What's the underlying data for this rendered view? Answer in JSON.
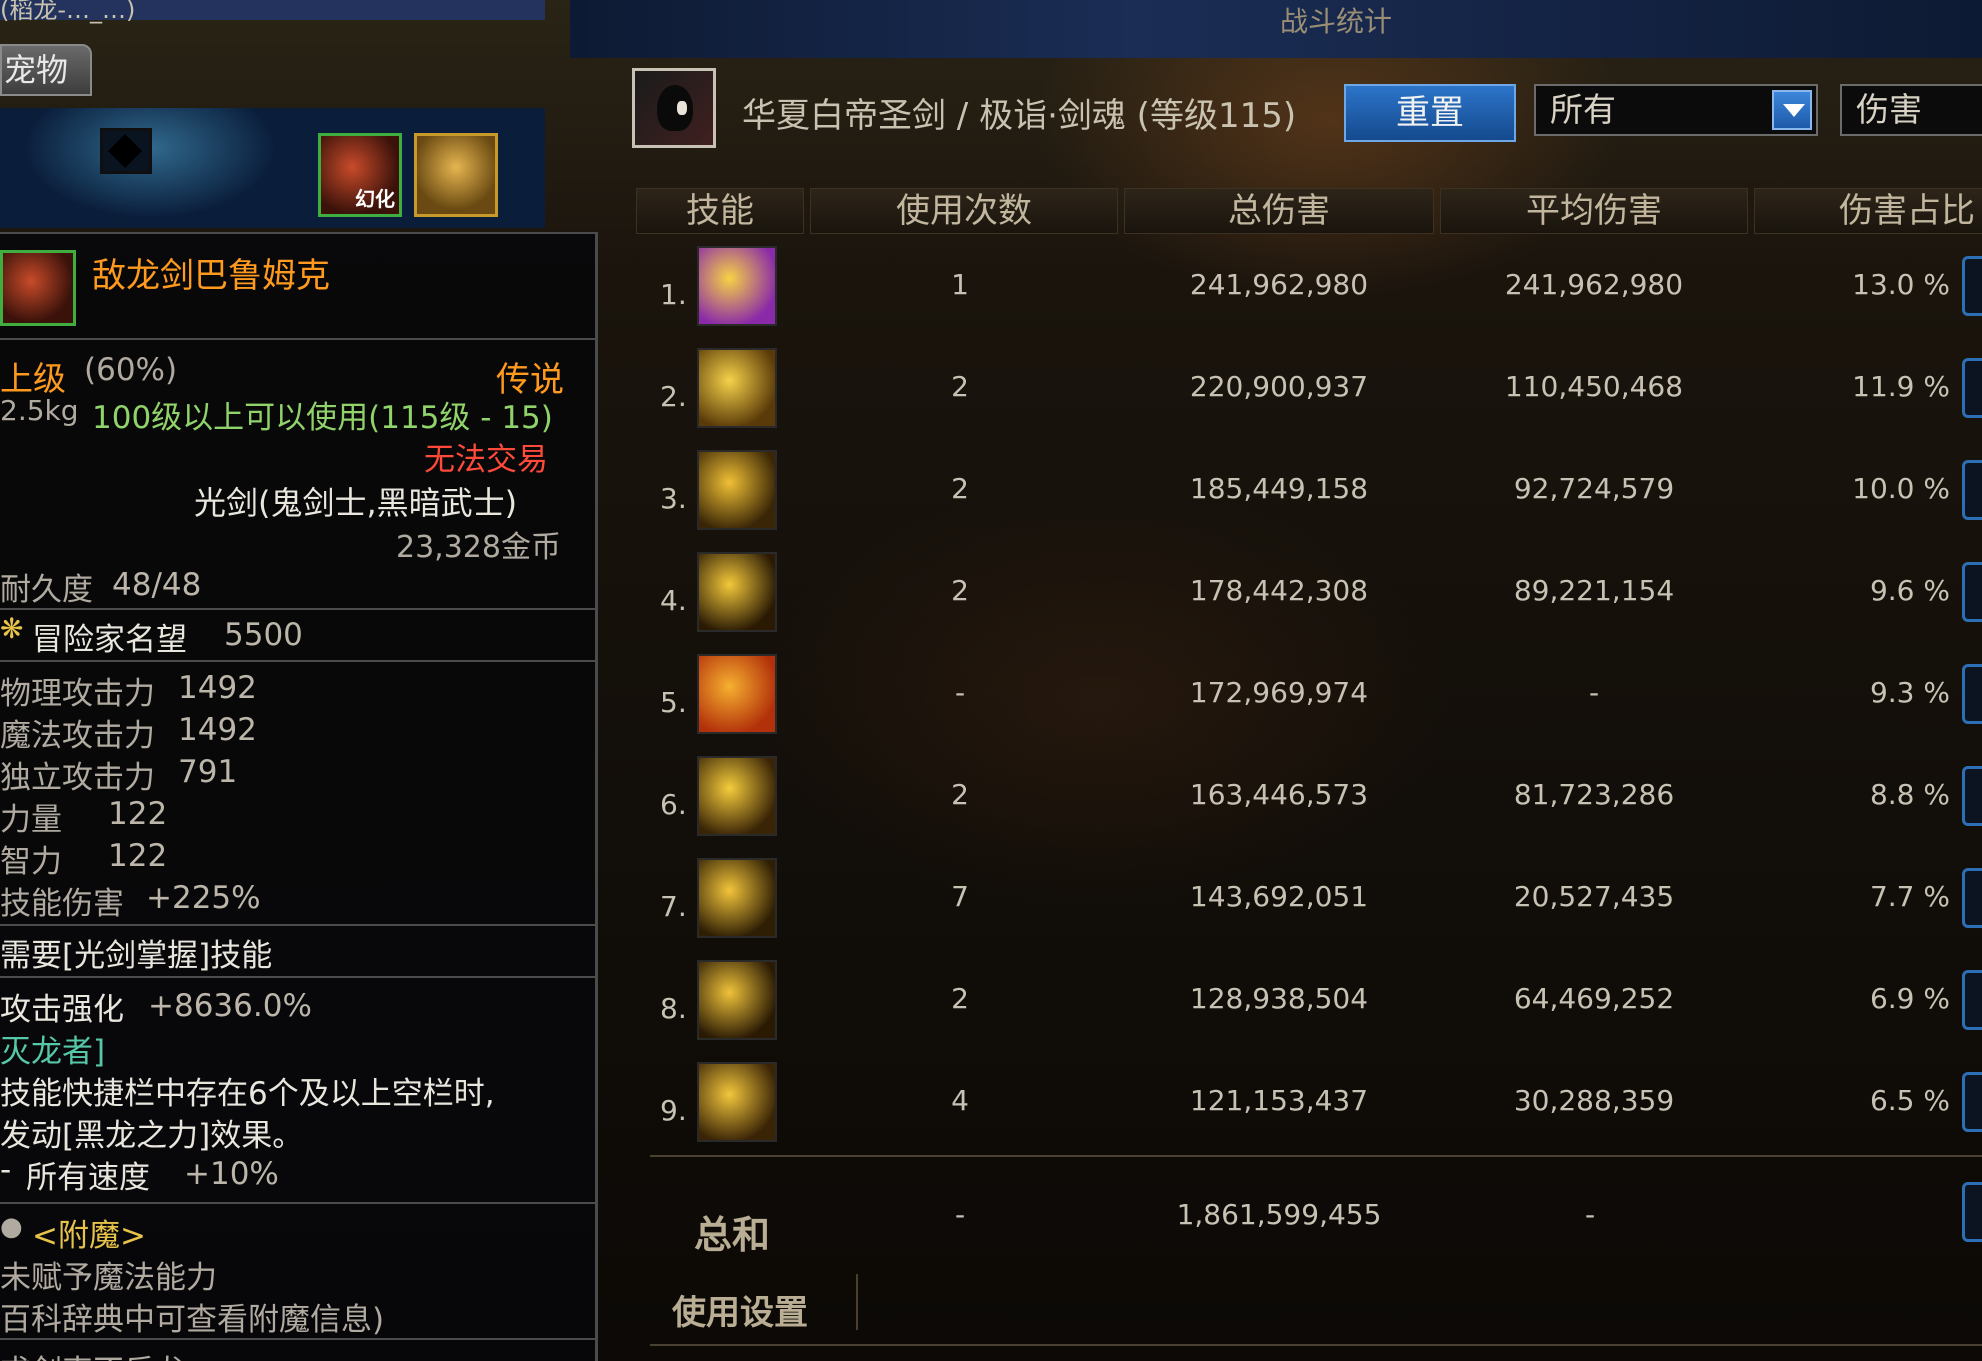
{
  "window": {
    "title": "战斗统计",
    "top_left_title": "(稻龙-…_…)"
  },
  "left": {
    "pet_tab": "宠物",
    "pet_icon_label": "幻化",
    "item": {
      "name": "敌龙剑巴鲁姆克",
      "grade": "上级",
      "grade_pct": "(60%)",
      "rarity": "传说",
      "weight": "2.5kg",
      "level_req": "100级以上可以使用(115级 - 15)",
      "trade": "无法交易",
      "type": "光剑(鬼剑士,黑暗武士)",
      "price": "23,328金币",
      "durability_label": "耐久度",
      "durability_value": "48/48",
      "renown_label": "冒险家名望",
      "renown_value": "5500",
      "stats": [
        {
          "label": "物理攻击力",
          "value": "1492"
        },
        {
          "label": "魔法攻击力",
          "value": "1492"
        },
        {
          "label": "独立攻击力",
          "value": "791"
        },
        {
          "label": "力量",
          "value": "122"
        },
        {
          "label": "智力",
          "value": "122"
        },
        {
          "label": "技能伤害",
          "value": "+225%"
        }
      ],
      "requires": "需要[光剑掌握]技能",
      "attack_enhance_label": "攻击强化",
      "attack_enhance_value": "+8636.0%",
      "set_name": "灭龙者]",
      "desc_line1": "技能快捷栏中存在6个及以上空栏时,",
      "desc_line2": "发动[黑龙之力]效果。",
      "speed_prefix": "-",
      "speed_label": "所有速度",
      "speed_value": "+10%",
      "enchant_title": "<附魔>",
      "enchant_line1": "未赋予魔法能力",
      "enchant_line2": "百科辞典中可查看附魔信息)",
      "bottom_text": "求剑索不反龙"
    }
  },
  "stats": {
    "character": "华夏白帝圣剑 / 极诣·剑魂 (等级115)",
    "reset_button": "重置",
    "filter_select": "所有",
    "metric_select": "伤害",
    "headers": [
      "技能",
      "使用次数",
      "总伤害",
      "平均伤害",
      "伤害占比"
    ],
    "rows": [
      {
        "idx": "1.",
        "uses": "1",
        "total": "241,962,980",
        "avg": "241,962,980",
        "pct": "13.0 %",
        "icon": "skill-burst-icon",
        "c1": "#f7d245",
        "c2": "#8a2aa8"
      },
      {
        "idx": "2.",
        "uses": "2",
        "total": "220,900,937",
        "avg": "110,450,468",
        "pct": "11.9 %",
        "icon": "skill-sword-rays-icon",
        "c1": "#f5d24a",
        "c2": "#5a3a08"
      },
      {
        "idx": "3.",
        "uses": "2",
        "total": "185,449,158",
        "avg": "92,724,579",
        "pct": "10.0 %",
        "icon": "skill-orbit-icon",
        "c1": "#f0c035",
        "c2": "#3a2606"
      },
      {
        "idx": "4.",
        "uses": "2",
        "total": "178,442,308",
        "avg": "89,221,154",
        "pct": "9.6 %",
        "icon": "skill-ring-slash-icon",
        "c1": "#f3c83a",
        "c2": "#2a1a04"
      },
      {
        "idx": "5.",
        "uses": "-",
        "total": "172,969,974",
        "avg": "-",
        "pct": "9.3 %",
        "icon": "skill-explosion-icon",
        "c1": "#f6b030",
        "c2": "#b2300a"
      },
      {
        "idx": "6.",
        "uses": "2",
        "total": "163,446,573",
        "avg": "81,723,286",
        "pct": "8.8 %",
        "icon": "skill-shatter-icon",
        "c1": "#f5cc3c",
        "c2": "#3a2406"
      },
      {
        "idx": "7.",
        "uses": "7",
        "total": "143,692,051",
        "avg": "20,527,435",
        "pct": "7.7 %",
        "icon": "skill-flow-icon",
        "c1": "#f2c43a",
        "c2": "#2e1e04"
      },
      {
        "idx": "8.",
        "uses": "2",
        "total": "128,938,504",
        "avg": "64,469,252",
        "pct": "6.9 %",
        "icon": "skill-wave-icon",
        "c1": "#efc23a",
        "c2": "#2a1a04"
      },
      {
        "idx": "9.",
        "uses": "4",
        "total": "121,153,437",
        "avg": "30,288,359",
        "pct": "6.5 %",
        "icon": "skill-dragon-icon",
        "c1": "#f2c63c",
        "c2": "#3a2406"
      }
    ],
    "total": {
      "label": "总和",
      "uses": "-",
      "total": "1,861,599,455",
      "avg": "-"
    },
    "settings_label": "使用设置"
  }
}
